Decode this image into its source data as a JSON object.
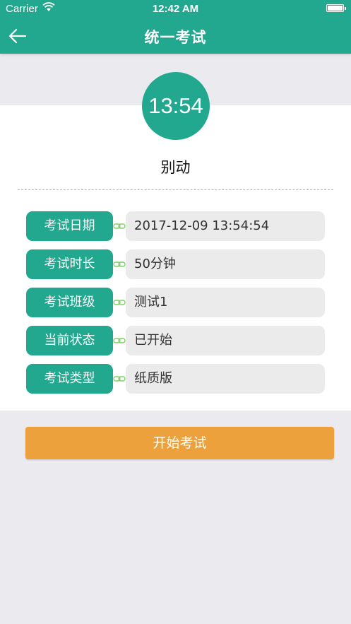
{
  "status_bar": {
    "carrier": "Carrier",
    "time": "12:42 AM",
    "wifi_icon": "wifi-icon",
    "battery_icon": "battery-icon"
  },
  "nav": {
    "title": "统一考试",
    "back_icon": "back-arrow-icon"
  },
  "timer": {
    "value": "13:54",
    "hint": "别动"
  },
  "info": [
    {
      "label": "考试日期",
      "value": "2017-12-09 13:54:54"
    },
    {
      "label": "考试时长",
      "value": "50分钟"
    },
    {
      "label": "考试班级",
      "value": "测试1"
    },
    {
      "label": "当前状态",
      "value": "已开始"
    },
    {
      "label": "考试类型",
      "value": "纸质版"
    }
  ],
  "actions": {
    "start_label": "开始考试"
  },
  "colors": {
    "primary": "#21a88e",
    "accent": "#eca13c",
    "background": "#ebeaef",
    "field": "#ebebeb"
  }
}
